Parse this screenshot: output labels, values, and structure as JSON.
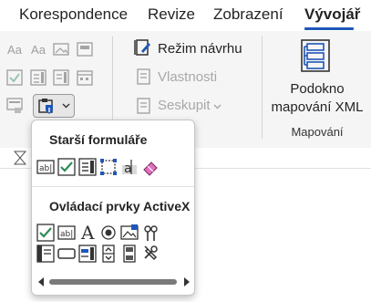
{
  "tabs": [
    {
      "label": "Korespondence"
    },
    {
      "label": "Revize"
    },
    {
      "label": "Zobrazení"
    },
    {
      "label": "Vývojář"
    }
  ],
  "ribbon": {
    "controls_group": {
      "design_mode_label": "Režim návrhu",
      "properties_label": "Vlastnosti",
      "group_label": "Seskupit"
    },
    "mapping_group": {
      "pane_label_line1": "Podokno",
      "pane_label_line2": "mapování XML",
      "group_title": "Mapování"
    }
  },
  "legacy_dropdown": {
    "legacy_forms_title": "Starší formuláře",
    "legacy_forms_icons": [
      "text-field-icon",
      "check-box-icon",
      "combo-box-icon",
      "frame-icon",
      "shading-icon",
      "eraser-icon"
    ],
    "activex_title": "Ovládací prvky ActiveX",
    "activex_icons": [
      "checkbox-icon",
      "textbox-icon",
      "label-icon",
      "option-button-icon",
      "image-icon",
      "toggle-button-icon",
      "combobox-icon",
      "command-button-icon",
      "listbox-icon",
      "spin-button-icon",
      "scroll-bar-icon",
      "more-controls-icon"
    ]
  },
  "colors": {
    "accent": "#1f57b8",
    "ribbon_bg": "#f5f5f5",
    "check_green": "#2e8b57",
    "eraser_pink": "#e36fbf"
  }
}
